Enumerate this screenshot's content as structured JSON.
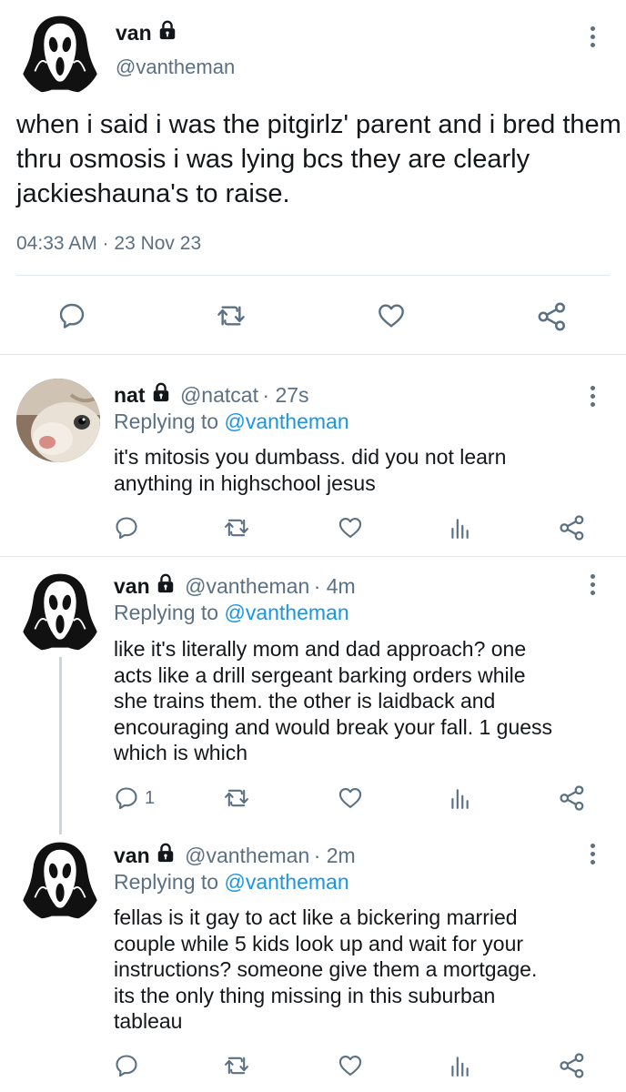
{
  "main_tweet": {
    "display_name": "van",
    "handle": "@vantheman",
    "text": "when i said i was the pitgirlz' parent and i bred them thru osmosis i was lying bcs they are clearly jackieshauna's to raise.",
    "timestamp": "04:33 AM · 23 Nov 23",
    "avatar_icon": "ghostface-mask-icon",
    "actions": [
      "reply-icon",
      "retweet-icon",
      "like-icon",
      "share-icon"
    ]
  },
  "replies": [
    {
      "display_name": "nat",
      "handle": "@natcat",
      "age": "· 27s",
      "replying_prefix": "Replying to",
      "replying_to": "@vantheman",
      "text_lines": [
        "it's mitosis you dumbass. did you not learn",
        "anything in highschool jesus"
      ],
      "avatar_icon": "cat-photo-avatar",
      "reply_count": ""
    },
    {
      "display_name": "van",
      "handle": "@vantheman",
      "age": "· 4m",
      "replying_prefix": "Replying to",
      "replying_to": "@vantheman",
      "text_lines": [
        "like it's literally mom and dad approach? one",
        "acts like a drill sergeant barking orders while",
        "she trains them. the other is laidback and",
        "encouraging and would break your fall. 1 guess",
        "which is which"
      ],
      "avatar_icon": "ghostface-mask-icon",
      "reply_count": "1"
    },
    {
      "display_name": "van",
      "handle": "@vantheman",
      "age": "· 2m",
      "replying_prefix": "Replying to",
      "replying_to": "@vantheman",
      "text_lines": [
        "fellas is it gay to act like a bickering married",
        "couple while 5 kids look up and wait for your",
        "instructions? someone give them a mortgage.",
        "its the only thing missing in this suburban",
        "tableau"
      ],
      "avatar_icon": "ghostface-mask-icon",
      "reply_count": ""
    }
  ],
  "colors": {
    "text": "#14171a",
    "secondary": "#5b7083",
    "link": "#1b95e0",
    "divider": "#e1e8ed"
  }
}
